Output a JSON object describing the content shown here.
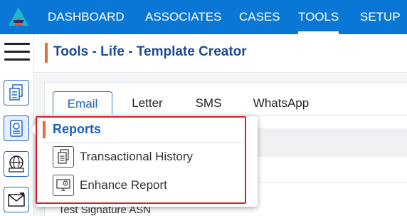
{
  "topnav": {
    "items": [
      {
        "label": "DASHBOARD",
        "active": false
      },
      {
        "label": "ASSOCIATES",
        "active": false
      },
      {
        "label": "CASES",
        "active": false
      },
      {
        "label": "TOOLS",
        "active": true
      },
      {
        "label": "SETUP",
        "active": false
      }
    ],
    "logo_icon": "app-logo-icon",
    "bar_color": "#0a77d6"
  },
  "sidebar": {
    "menu_icon": "hamburger-menu-icon",
    "items": [
      {
        "icon": "documents-icon",
        "active": false
      },
      {
        "icon": "reports-icon",
        "active": true
      },
      {
        "icon": "website-icon",
        "active": false
      },
      {
        "icon": "mail-icon",
        "active": false
      }
    ]
  },
  "header": {
    "title": "Tools - Life - Template Creator",
    "accent_color": "#f06a35"
  },
  "tabs": [
    {
      "label": "Email",
      "active": true
    },
    {
      "label": "Letter",
      "active": false
    },
    {
      "label": "SMS",
      "active": false
    },
    {
      "label": "WhatsApp",
      "active": false
    }
  ],
  "content": {
    "partial_row_text": "Test Signature ASN"
  },
  "reports_menu": {
    "title": "Reports",
    "items": [
      {
        "label": "Transactional History",
        "icon": "transactional-history-icon"
      },
      {
        "label": "Enhance Report",
        "icon": "enhance-report-icon"
      }
    ],
    "highlight_color": "#d2232a"
  }
}
